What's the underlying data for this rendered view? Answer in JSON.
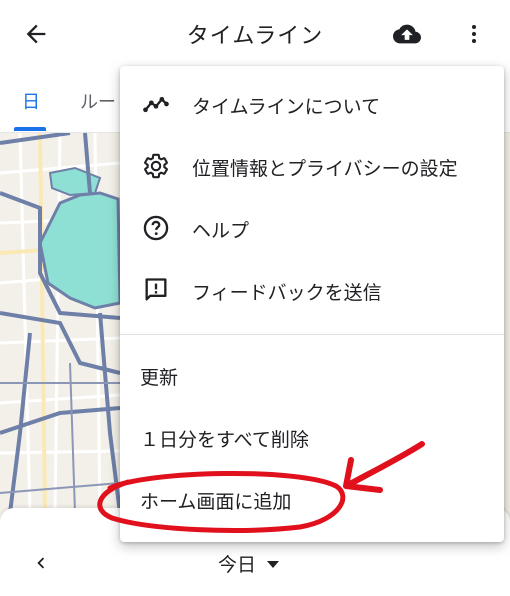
{
  "appbar": {
    "title": "タイムライン",
    "icons": {
      "back": "arrow-back-icon",
      "upload": "cloud-upload-icon",
      "more": "more-vert-icon"
    }
  },
  "tabs": [
    {
      "label": "日",
      "active": true
    },
    {
      "label": "ルー",
      "active": false
    }
  ],
  "menu": {
    "items": [
      {
        "label": "タイムラインについて",
        "icon": "timeline-icon"
      },
      {
        "label": "位置情報とプライバシーの設定",
        "icon": "gear-icon"
      },
      {
        "label": "ヘルプ",
        "icon": "help-icon"
      },
      {
        "label": "フィードバックを送信",
        "icon": "feedback-icon"
      },
      {
        "label": "更新"
      },
      {
        "label": "１日分をすべて削除"
      },
      {
        "label": "ホーム画面に追加",
        "highlighted": true
      }
    ]
  },
  "bottombar": {
    "date_label": "今日",
    "icons": {
      "prev": "chevron-left-icon",
      "dropdown": "triangle-down-icon"
    }
  },
  "colors": {
    "accent": "#1a73e8",
    "annotation": "#e0101c",
    "map_park": "#8fe0d4",
    "map_road": "#6e7fa8"
  }
}
